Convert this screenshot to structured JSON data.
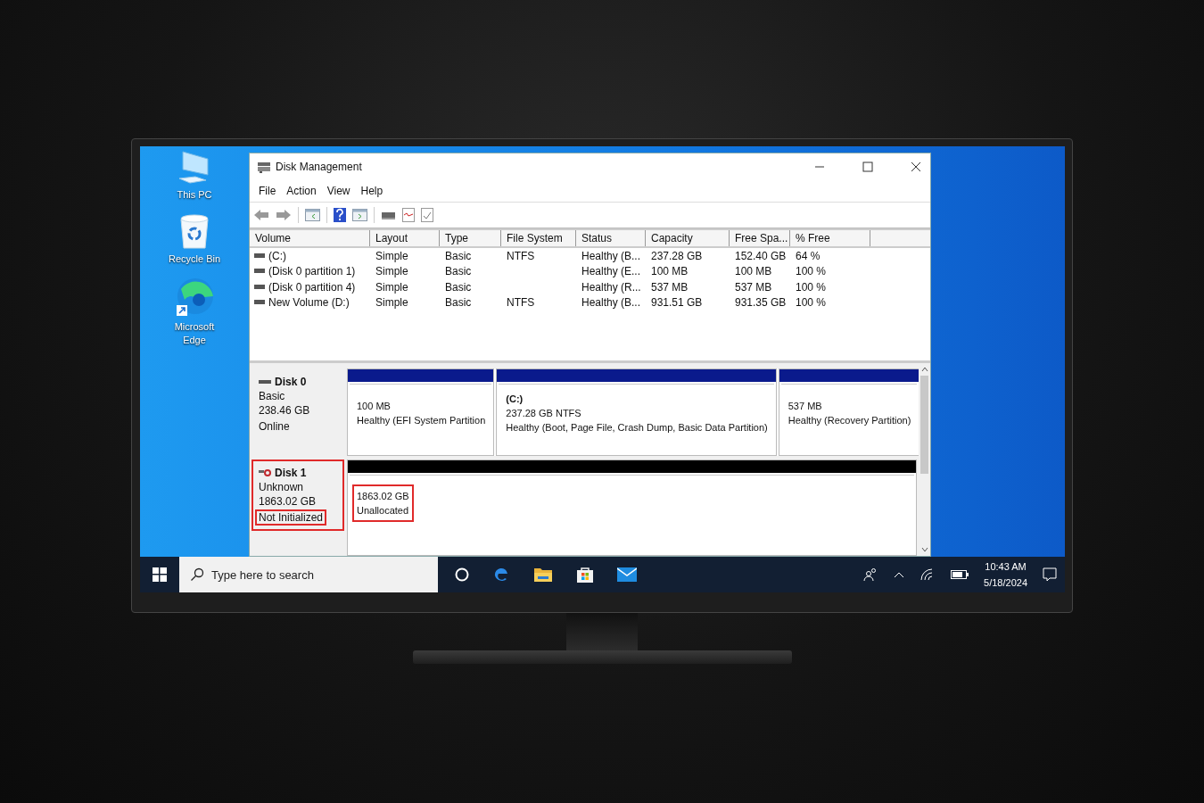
{
  "desktop_icons": [
    {
      "label": "This PC",
      "kind": "computer"
    },
    {
      "label": "Recycle Bin",
      "kind": "bin"
    },
    {
      "label": "Microsoft Edge",
      "kind": "browser"
    }
  ],
  "window": {
    "title": "Disk Management"
  },
  "menu": [
    "File",
    "Action",
    "View",
    "Help"
  ],
  "volume_table": {
    "columns": [
      "Volume",
      "Layout",
      "Type",
      "File System",
      "Status",
      "Capacity",
      "Free Spa...",
      "% Free"
    ],
    "rows": [
      {
        "volume": "(C:)",
        "layout": "Simple",
        "type": "Basic",
        "file_system": "NTFS",
        "status": "Healthy (B...",
        "capacity": "237.28 GB",
        "free_space": "152.40 GB",
        "percent_free": "64 %"
      },
      {
        "volume": "(Disk 0 partition 1)",
        "layout": "Simple",
        "type": "Basic",
        "status": "Healthy (E...",
        "capacity": "100 MB",
        "free_space": "100 MB",
        "percent_free": "100 %"
      },
      {
        "volume": "(Disk 0 partition 4)",
        "layout": "Simple",
        "type": "Basic",
        "status": "Healthy (R...",
        "capacity": "537 MB",
        "free_space": "537 MB",
        "percent_free": "100 %"
      },
      {
        "volume": "New Volume (D:)",
        "layout": "Simple",
        "type": "Basic",
        "file_system": "NTFS",
        "status": "Healthy (B...",
        "capacity": "931.51 GB",
        "free_space": "931.35 GB",
        "percent_free": "100 %"
      }
    ]
  },
  "disks": [
    {
      "name": "Disk 0",
      "kind": "online",
      "type": "Basic",
      "size": "238.46 GB",
      "status": "Online",
      "highlighted": false,
      "status_highlighted": false,
      "partitions": [
        {
          "kind": "primary",
          "size": "100 MB",
          "status": "Healthy (EFI System Partition",
          "highlighted": false
        },
        {
          "kind": "primary",
          "label": "(C:)",
          "size": "237.28 GB NTFS",
          "status": "Healthy (Boot, Page File, Crash Dump, Basic Data Partition)",
          "highlighted": false
        },
        {
          "kind": "primary",
          "size": "537 MB",
          "status": "Healthy (Recovery Partition)",
          "highlighted": false
        }
      ]
    },
    {
      "name": "Disk 1",
      "kind": "uninitialized",
      "type": "Unknown",
      "size": "1863.02 GB",
      "status": "Not Initialized",
      "highlighted": true,
      "status_highlighted": true,
      "partitions": [
        {
          "kind": "unallocated",
          "size": "1863.02 GB",
          "status": "Unallocated",
          "highlighted": true
        }
      ]
    }
  ],
  "taskbar": {
    "search": {
      "placeholder": "Type here to search"
    },
    "time": "10:43 AM",
    "date": "5/18/2024"
  }
}
